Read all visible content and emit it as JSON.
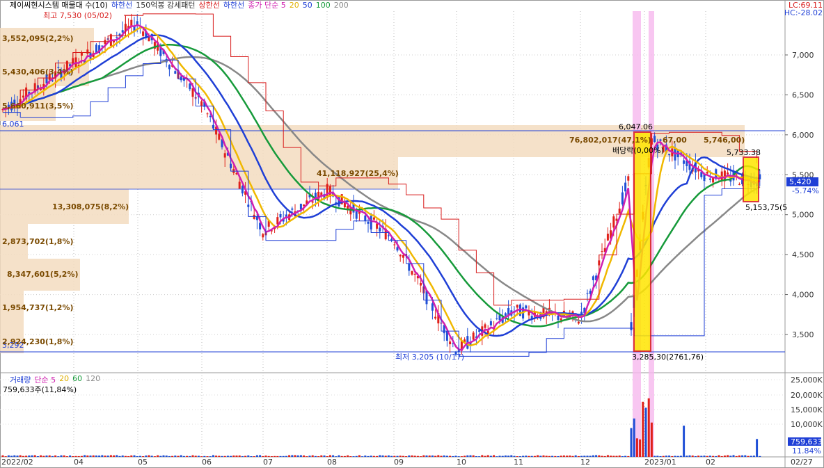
{
  "header": {
    "title": "제이씨현시스템 매물대 수(10)",
    "items": [
      {
        "label": "하한선",
        "color": "#1f3fd6"
      },
      {
        "label": "150억봉 강세패턴",
        "color": "#333333"
      },
      {
        "label": "상한선",
        "color": "#d81b1b"
      },
      {
        "label": "하한선",
        "color": "#1f3fd6"
      },
      {
        "label": "종가 단순 5",
        "color": "#d01fb0"
      },
      {
        "label": "20",
        "color": "#e0b000"
      },
      {
        "label": "50",
        "color": "#1f3fd6"
      },
      {
        "label": "100",
        "color": "#169a3a"
      },
      {
        "label": "200",
        "color": "#888888"
      }
    ],
    "lc": "LC:69.11",
    "hc": "HC:-28.02"
  },
  "price_annotations": {
    "high": "최고 7,530 (05/02)",
    "low": "최저 3,205 (10/17)",
    "line_6061": "6,061",
    "line_3292": "3,292",
    "pt_6047": "6,047.06",
    "big_vol": "76,802,017(47,1%)",
    "vals_67": "67,00",
    "vals_5746": "5,746,00)",
    "dividend": "배당락(0,00%)",
    "pt_5733": "5,733.38",
    "pt_5153": "5,153,75(5",
    "low_pair": "3,285,30(2761,76)",
    "vol_411": "41,118,927(25,4%)",
    "current": "5,420",
    "current_pct": "-5.74%"
  },
  "volume_profile": [
    {
      "label": "3,552,095(2,2%)"
    },
    {
      "label": "5,430,406(3,4%)"
    },
    {
      "label": "5,660,911(3,5%)"
    },
    {
      "label": "41,118,927(25,4%)"
    },
    {
      "label": "13,308,075(8,2%)"
    },
    {
      "label": "2,873,702(1,8%)"
    },
    {
      "label": "8,347,601(5,2%)"
    },
    {
      "label": "1,954,737(1,2%)"
    },
    {
      "label": "2,924,230(1,8%)"
    },
    {
      "label": "76,802,017(47,1%)"
    }
  ],
  "volume_panel": {
    "title_items": [
      {
        "label": "거래량",
        "color": "#1f3fd6"
      },
      {
        "label": "단순 5",
        "color": "#d01fb0"
      },
      {
        "label": "20",
        "color": "#e0b000"
      },
      {
        "label": "60",
        "color": "#169a3a"
      },
      {
        "label": "120",
        "color": "#888888"
      }
    ],
    "current": "759,633주(11,84%)",
    "axis_labels": [
      "25,000K",
      "20,000K",
      "15,000K",
      "10,000K"
    ],
    "current_tag": "759,633",
    "current_pct": "11.84%"
  },
  "x_axis": [
    "2022/02",
    "04",
    "05",
    "06",
    "07",
    "08",
    "09",
    "10",
    "11",
    "12",
    "2023/01",
    "02",
    "02/27"
  ],
  "chart_data": {
    "type": "candlestick",
    "title": "제이씨현시스템",
    "y_axis_ticks": [
      7000,
      6500,
      6000,
      5500,
      5000,
      4500,
      4000,
      3500
    ],
    "ylim": [
      3200,
      7600
    ],
    "high": 7530,
    "low": 3205,
    "last_close": 5420,
    "price_path": [
      {
        "month": "2022/02",
        "price": 6300
      },
      {
        "month": "04",
        "price": 6900
      },
      {
        "month": "05",
        "price": 7400
      },
      {
        "month": "06",
        "price": 6400
      },
      {
        "month": "07",
        "price": 4800
      },
      {
        "month": "08",
        "price": 5300
      },
      {
        "month": "09",
        "price": 4700
      },
      {
        "month": "10",
        "price": 3300
      },
      {
        "month": "11",
        "price": 3800
      },
      {
        "month": "12",
        "price": 3700
      },
      {
        "month": "2023/01",
        "price": 6000
      },
      {
        "month": "02",
        "price": 5500
      },
      {
        "month": "02/27",
        "price": 5420
      }
    ],
    "volume_ticks": [
      25000,
      20000,
      15000,
      10000
    ],
    "last_volume": 759633
  }
}
